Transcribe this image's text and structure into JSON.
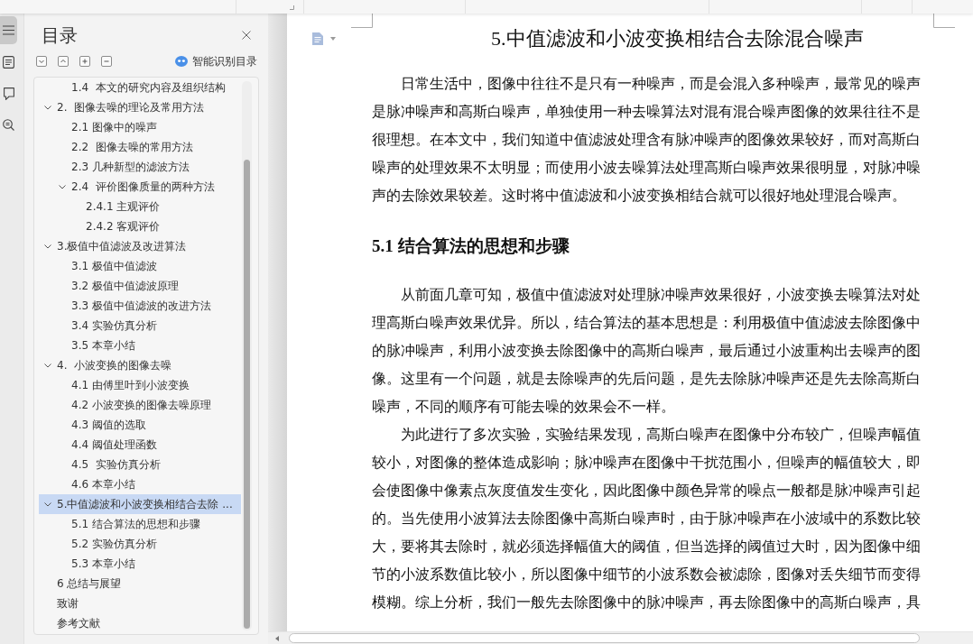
{
  "rail": [
    {
      "kind": "menu",
      "selected": true
    },
    {
      "kind": "list",
      "selected": false
    },
    {
      "kind": "bookmark",
      "selected": false
    },
    {
      "kind": "search",
      "selected": false
    }
  ],
  "sidebar": {
    "title": "目录",
    "smart_toc_label": "智能识别目录",
    "toc": [
      {
        "children": [
          {
            "label": "1.4  本文的研究内容及组织结构",
            "selected": false
          }
        ]
      },
      {
        "label": "2.  图像去噪的理论及常用方法",
        "selected": false,
        "expanded": true,
        "children": [
          {
            "label": "2.1 图像中的噪声",
            "selected": false
          },
          {
            "label": "2.2  图像去噪的常用方法",
            "selected": false
          },
          {
            "label": "2.3 几种新型的滤波方法",
            "selected": false
          },
          {
            "label": "2.4  评价图像质量的两种方法",
            "selected": false,
            "expanded": true,
            "children": [
              {
                "label": "2.4.1 主观评价",
                "selected": false
              },
              {
                "label": "2.4.2 客观评价",
                "selected": false
              }
            ]
          }
        ]
      },
      {
        "label": "3.极值中值滤波及改进算法",
        "selected": false,
        "expanded": true,
        "children": [
          {
            "label": "3.1 极值中值滤波",
            "selected": false
          },
          {
            "label": "3.2 极值中值滤波原理",
            "selected": false
          },
          {
            "label": "3.3 极值中值滤波的改进方法",
            "selected": false
          },
          {
            "label": "3.4 实验仿真分析",
            "selected": false
          },
          {
            "label": "3.5 本章小结",
            "selected": false
          }
        ]
      },
      {
        "label": "4.  小波变换的图像去噪",
        "selected": false,
        "expanded": true,
        "children": [
          {
            "label": "4.1 由傅里叶到小波变换",
            "selected": false
          },
          {
            "label": "4.2 小波变换的图像去噪原理",
            "selected": false
          },
          {
            "label": "4.3 阈值的选取",
            "selected": false
          },
          {
            "label": "4.4 阈值处理函数",
            "selected": false
          },
          {
            "label": "4.5  实验仿真分析",
            "selected": false
          },
          {
            "label": "4.6 本章小结",
            "selected": false
          }
        ]
      },
      {
        "label": "5.中值滤波和小波变换相结合去除 ...",
        "selected": true,
        "expanded": true,
        "children": [
          {
            "label": "5.1 结合算法的思想和步骤",
            "selected": false
          },
          {
            "label": "5.2 实验仿真分析",
            "selected": false
          },
          {
            "label": "5.3 本章小结",
            "selected": false
          }
        ]
      },
      {
        "label": "6 总结与展望",
        "selected": false
      },
      {
        "label": "致谢",
        "selected": false
      },
      {
        "label": "参考文献",
        "selected": false
      }
    ]
  },
  "document": {
    "title": "5.中值滤波和小波变换相结合去除混合噪声",
    "blocks": [
      {
        "kind": "paragraph",
        "text": "日常生活中，图像中往往不是只有一种噪声，而是会混入多种噪声，最常见的噪声是脉冲噪声和高斯白噪声，单独使用一种去噪算法对混有混合噪声图像的效果往往不是很理想。在本文中，我们知道中值滤波处理含有脉冲噪声的图像效果较好，而对高斯白噪声的处理效果不太明显；而使用小波去噪算法处理高斯白噪声效果很明显，对脉冲噪声的去除效果较差。这时将中值滤波和小波变换相结合就可以很好地处理混合噪声。"
      },
      {
        "kind": "heading",
        "text": "5.1 结合算法的思想和步骤"
      },
      {
        "kind": "paragraph",
        "text": "从前面几章可知，极值中值滤波对处理脉冲噪声效果很好，小波变换去噪算法对处理高斯白噪声效果优异。所以，结合算法的基本思想是：利用极值中值滤波去除图像中的脉冲噪声，利用小波变换去除图像中的高斯白噪声，最后通过小波重构出去噪声的图像。这里有一个问题，就是去除噪声的先后问题，是先去除脉冲噪声还是先去除高斯白噪声，不同的顺序有可能去噪的效果会不一样。"
      },
      {
        "kind": "paragraph",
        "text": "为此进行了多次实验，实验结果发现，高斯白噪声在图像中分布较广，但噪声幅值较小，对图像的整体造成影响；脉冲噪声在图像中干扰范围小，但噪声的幅值较大，即会使图像中像素点灰度值发生变化，因此图像中颜色异常的噪点一般都是脉冲噪声引起的。当先使用小波算法去除图像中高斯白噪声时，由于脉冲噪声在小波域中的系数比较大，要将其去除时，就必须选择幅值大的阈值，但当选择的阈值过大时，因为图像中细节的小波系数值比较小，所以图像中细节的小波系数会被滤除，图像对丢失细节而变得模糊。综上分析，我们一般先去除图像中的脉冲噪声，再去除图像中的高斯白噪声，具"
      }
    ]
  }
}
